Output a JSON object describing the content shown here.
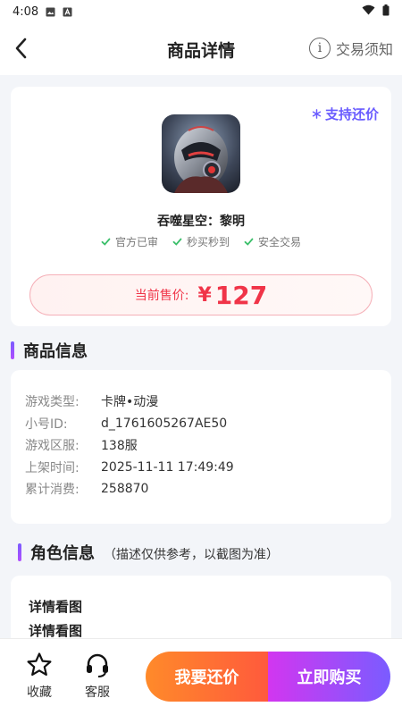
{
  "status_bar": {
    "time": "4:08"
  },
  "header": {
    "title": "商品详情",
    "notice_label": "交易须知",
    "notice_icon": "i"
  },
  "product": {
    "bargain_tag": "支持还价",
    "game_name": "吞噬星空：黎明",
    "guarantees": [
      "官方已审",
      "秒买秒到",
      "安全交易"
    ],
    "price_label": "当前售价:",
    "price_symbol": "¥",
    "price_value": "127"
  },
  "info_section": {
    "title": "商品信息",
    "rows": [
      {
        "key": "游戏类型:",
        "value": "卡牌•动漫"
      },
      {
        "key": "小号ID:",
        "value": "d_1761605267AE50"
      },
      {
        "key": "游戏区服:",
        "value": "138服"
      },
      {
        "key": "上架时间:",
        "value": "2025-11-11 17:49:49"
      },
      {
        "key": "累计消费:",
        "value": "258870"
      }
    ]
  },
  "role_section": {
    "title": "角色信息",
    "subtitle": "（描述仅供参考，以截图为准）",
    "detail_title": "详情看图",
    "detail_text": "详情看图"
  },
  "bottom_bar": {
    "favorite_label": "收藏",
    "service_label": "客服",
    "bargain_button": "我要还价",
    "buy_button": "立即购买"
  },
  "colors": {
    "accent_purple": "#6a5cff",
    "price_red": "#f03448",
    "check_green": "#3bbf6a",
    "bargain_orange": "#ff6f33",
    "buy_purple": "#a84cf5"
  }
}
